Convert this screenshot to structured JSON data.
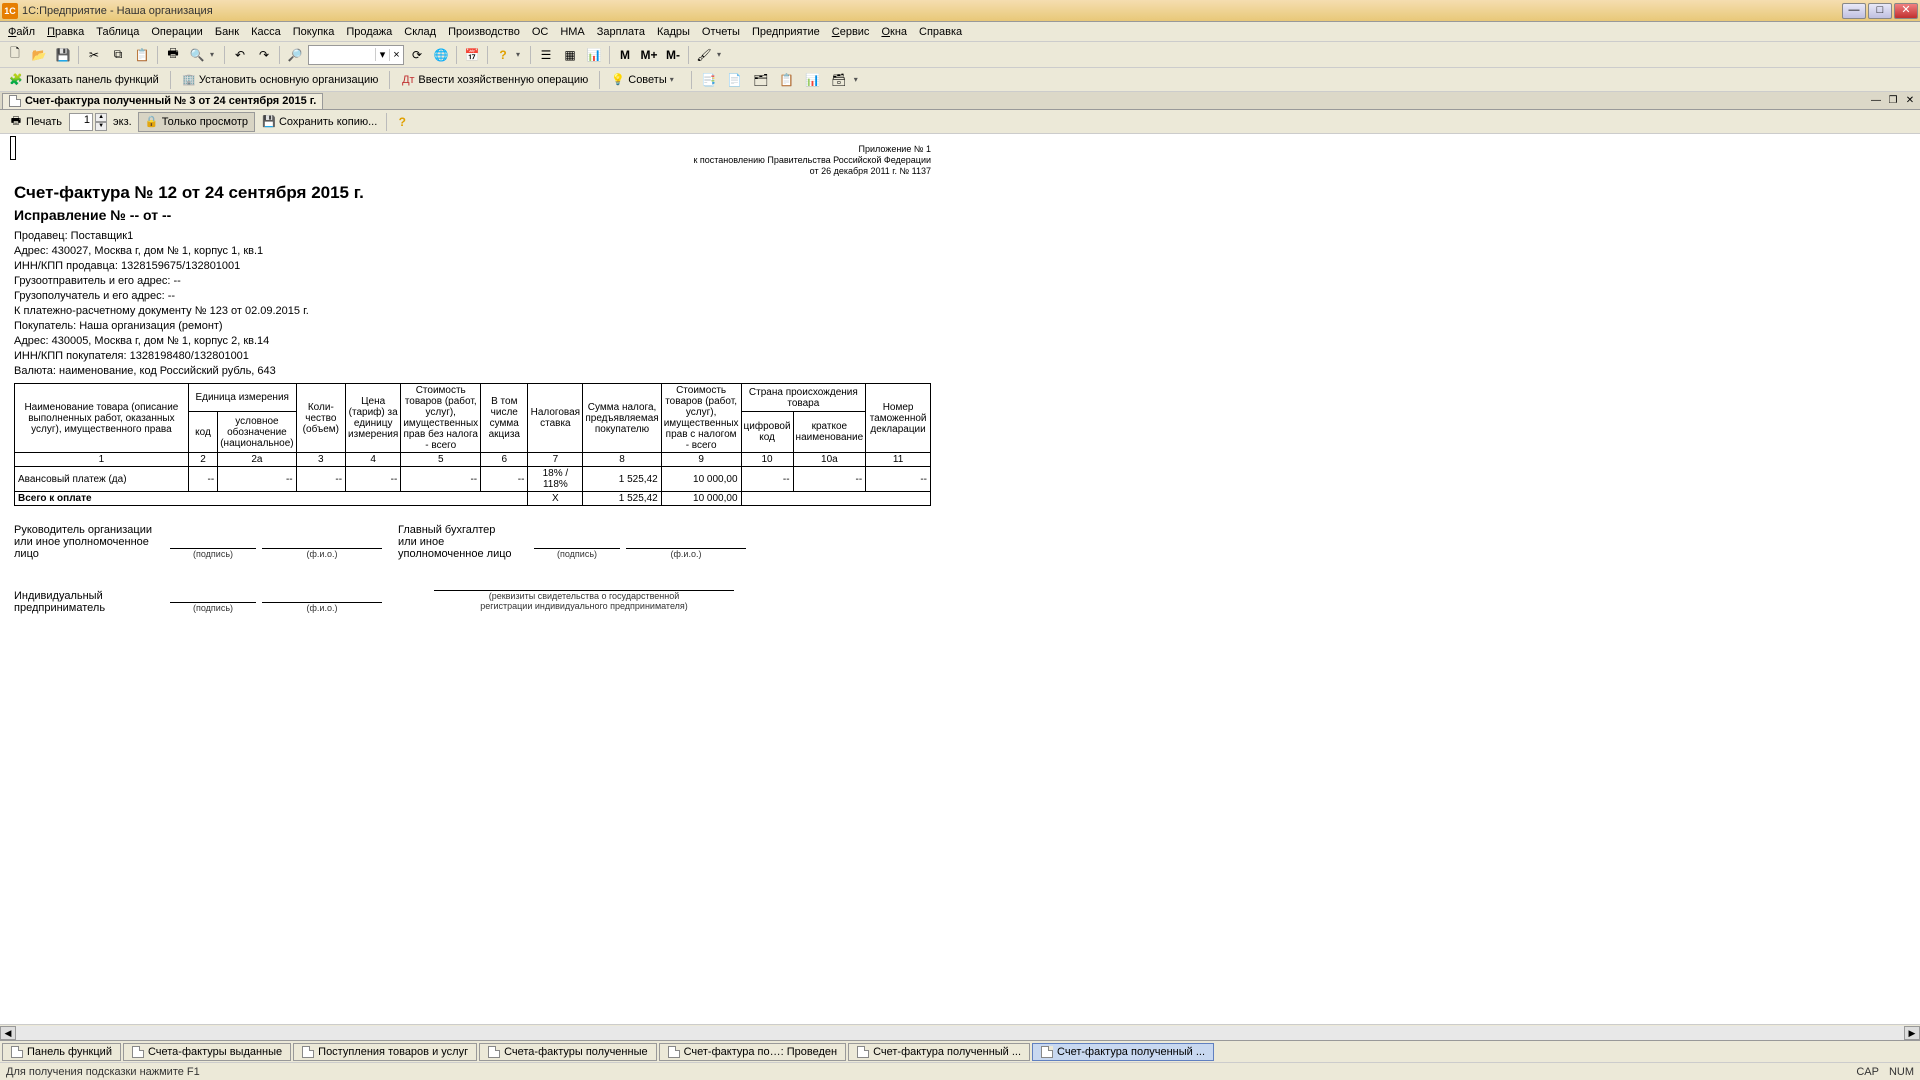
{
  "window_title": "1С:Предприятие - Наша организация",
  "menu": [
    "Файл",
    "Правка",
    "Таблица",
    "Операции",
    "Банк",
    "Касса",
    "Покупка",
    "Продажа",
    "Склад",
    "Производство",
    "ОС",
    "НМА",
    "Зарплата",
    "Кадры",
    "Отчеты",
    "Предприятие",
    "Сервис",
    "Окна",
    "Справка"
  ],
  "toolbar3": {
    "showpanel": "Показать панель функций",
    "setorg": "Установить основную организацию",
    "enterop": "Ввести хозяйственную операцию",
    "tips": "Советы"
  },
  "doctab_title": "Счет-фактура полученный № 3 от 24 сентября 2015 г.",
  "print_btn": "Печать",
  "copies": "1",
  "copies_unit": "экз.",
  "viewonly": "Только просмотр",
  "savecopy": "Сохранить копию...",
  "appendix": {
    "l1": "Приложение № 1",
    "l2": "к постановлению Правительства Российской Федерации",
    "l3": "от 26 декабря 2011 г. № 1137"
  },
  "title": "Счет-фактура № 12 от 24 сентября 2015 г.",
  "subtitle": "Исправление № -- от --",
  "info": {
    "seller": "Продавец: Поставщик1",
    "addr": "Адрес: 430027, Москва г, дом № 1, корпус 1, кв.1",
    "inn": "ИНН/КПП продавца: 1328159675/132801001",
    "shipper": "Грузоотправитель и его адрес: --",
    "consignee": "Грузополучатель и его адрес: --",
    "paydoc": "К платежно-расчетному документу № 123 от 02.09.2015 г.",
    "buyer": "Покупатель: Наша организация (ремонт)",
    "baddr": "Адрес: 430005, Москва г, дом № 1, корпус 2, кв.14",
    "binn": "ИНН/КПП покупателя: 1328198480/132801001",
    "currency": "Валюта: наименование, код Российский рубль, 643"
  },
  "headers": {
    "h1": "Наименование товара (описание выполненных работ, оказанных услуг), имущественного права",
    "h2": "Единица измерения",
    "h2a": "код",
    "h2b": "условное обозначение (национальное)",
    "h3": "Коли-\nчество (объем)",
    "h4": "Цена (тариф) за единицу измерения",
    "h5": "Стоимость товаров (работ, услуг), имущественных прав без налога - всего",
    "h6": "В том числе сумма акциза",
    "h7": "Налоговая ставка",
    "h8": "Сумма налога, предъявляемая покупателю",
    "h9": "Стоимость товаров (работ, услуг), имущественных прав с налогом - всего",
    "h10": "Страна происхождения товара",
    "h10a": "цифровой код",
    "h10b": "краткое наименование",
    "h11": "Номер таможенной декларации"
  },
  "colnums": [
    "1",
    "2",
    "2а",
    "3",
    "4",
    "5",
    "6",
    "7",
    "8",
    "9",
    "10",
    "10а",
    "11"
  ],
  "row": {
    "name": "Авансовый платеж (да)",
    "code": "--",
    "unit": "--",
    "qty": "--",
    "price": "--",
    "cost": "--",
    "excise": "--",
    "rate": "18% / 118%",
    "tax": "1 525,42",
    "sum": "10 000,00",
    "ccode": "--",
    "cname": "--",
    "decl": "--"
  },
  "total": {
    "label": "Всего к оплате",
    "rate": "X",
    "tax": "1 525,42",
    "sum": "10 000,00"
  },
  "sign": {
    "head": "Руководитель организации",
    "headalt": "или иное уполномоченное лицо",
    "acc": "Главный бухгалтер",
    "accalt": "или иное уполномоченное лицо",
    "ip": "Индивидуальный предприниматель",
    "sub_sign": "(подпись)",
    "sub_fio": "(ф.и.о.)",
    "sub_cert": "(реквизиты свидетельства о государственной\nрегистрации индивидуального предпринимателя)"
  },
  "tabs": [
    "Панель функций",
    "Счета-фактуры выданные",
    "Поступления товаров и услуг",
    "Счета-фактуры полученные",
    "Счет-фактура по…: Проведен",
    "Счет-фактура полученный ...",
    "Счет-фактура полученный ..."
  ],
  "status": "Для получения подсказки нажмите F1",
  "cap": "CAP",
  "num": "NUM"
}
